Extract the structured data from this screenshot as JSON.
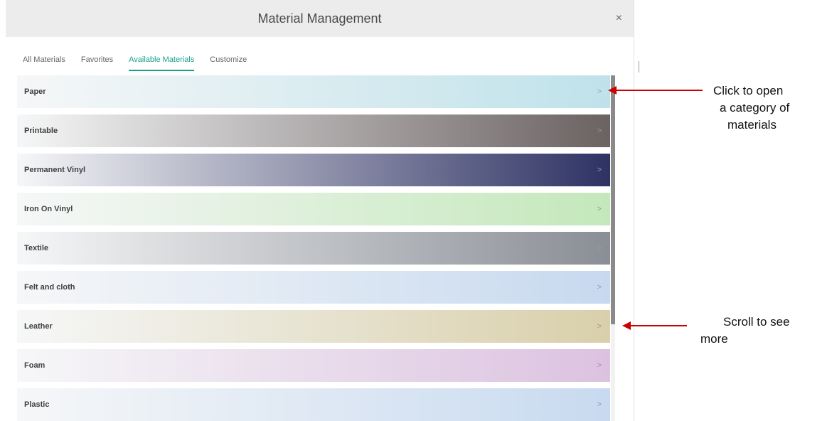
{
  "dialog": {
    "title": "Material Management",
    "close_glyph": "×"
  },
  "tabs": [
    {
      "label": "All Materials",
      "active": false
    },
    {
      "label": "Favorites",
      "active": false
    },
    {
      "label": "Available Materials",
      "active": true
    },
    {
      "label": "Customize",
      "active": false
    }
  ],
  "categories": [
    {
      "label": "Paper",
      "chevron": ">",
      "color": "#bfe2ea"
    },
    {
      "label": "Printable",
      "chevron": ">",
      "color": "#6b6262"
    },
    {
      "label": "Permanent Vinyl",
      "chevron": ">",
      "color": "#2e3263"
    },
    {
      "label": "Iron On Vinyl",
      "chevron": ">",
      "color": "#c4e8bb"
    },
    {
      "label": "Textile",
      "chevron": ">",
      "color": "#8a8e95"
    },
    {
      "label": "Felt and cloth",
      "chevron": ">",
      "color": "#c7d9ef"
    },
    {
      "label": "Leather",
      "chevron": ">",
      "color": "#d9cfaa"
    },
    {
      "label": "Foam",
      "chevron": ">",
      "color": "#dcc2e0"
    },
    {
      "label": "Plastic",
      "chevron": ">",
      "color": "#c8daf0"
    }
  ],
  "annotations": {
    "open_line1": "Click to open",
    "open_line2": "a category of",
    "open_line3": "materials",
    "scroll_line1": "Scroll to see",
    "scroll_line2": "more",
    "arrow_color": "#cc0000"
  },
  "colors": {
    "accent": "#1a9f8d",
    "titlebar": "#ececec"
  },
  "icons": {
    "close": "close-icon",
    "chevron": "chevron-right-icon"
  }
}
